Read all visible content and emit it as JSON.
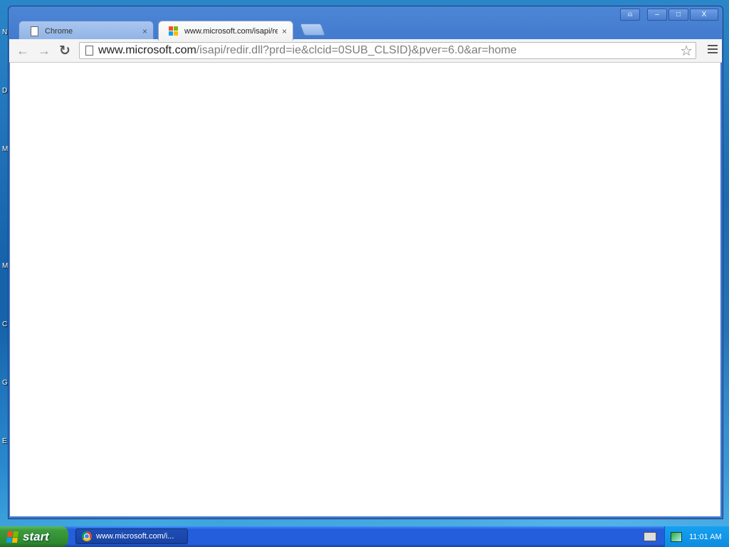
{
  "desktop": {
    "icon_letters": [
      "N",
      "D",
      "M",
      "M",
      "C",
      "G",
      "E"
    ]
  },
  "window": {
    "controls": {
      "profile": "⍝",
      "minimize": "–",
      "maximize": "□",
      "close": "X"
    }
  },
  "tabs": [
    {
      "title": "Chrome",
      "icon": "page-icon",
      "close": "×"
    },
    {
      "title": "www.microsoft.com/isapi/redi",
      "icon": "microsoft-logo-icon",
      "close": "×"
    }
  ],
  "toolbar": {
    "back": "←",
    "forward": "→",
    "reload": "↻",
    "url_domain": "www.microsoft.com",
    "url_rest": "/isapi/redir.dll?prd=ie&clcid=0SUB_CLSID}&pver=6.0&ar=home",
    "star": "☆"
  },
  "taskbar": {
    "start_label": "start",
    "task_item_label": "www.microsoft.com/i...",
    "clock": "11:01 AM"
  },
  "colors": {
    "ms_red": "#f25022",
    "ms_green": "#7fba00",
    "ms_blue": "#00a4ef",
    "ms_yellow": "#ffb900"
  }
}
